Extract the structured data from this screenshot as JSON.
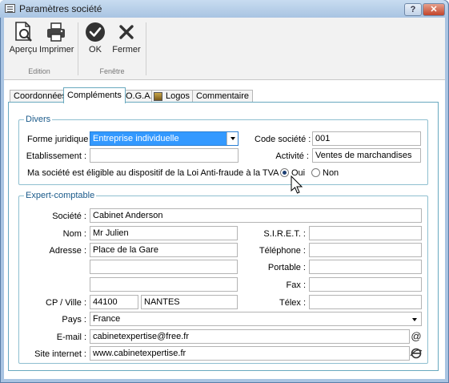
{
  "window": {
    "title": "Paramètres société",
    "help_label": "?",
    "close_label": "✕"
  },
  "toolbar": {
    "apercu": "Aperçu",
    "imprimer": "Imprimer",
    "ok": "OK",
    "fermer": "Fermer",
    "group_edition": "Edition",
    "group_fenetre": "Fenêtre"
  },
  "tabs": [
    "Coordonnées",
    "Compléments",
    "O.G.A.",
    "Logos",
    "Commentaire"
  ],
  "divers": {
    "title": "Divers",
    "forme_label": "Forme juridique :",
    "forme_value": "Entreprise individuelle",
    "code_label": "Code société :",
    "code_value": "001",
    "etablissement_label": "Etablissement :",
    "etablissement_value": "",
    "activite_label": "Activité :",
    "activite_value": "Ventes de marchandises",
    "antifraude_text": "Ma société est éligible au dispositif de la Loi Anti-fraude à la TVA",
    "oui_label": "Oui",
    "non_label": "Non",
    "antifraude_selected": "Oui"
  },
  "expert": {
    "title": "Expert-comptable",
    "societe_label": "Société :",
    "societe_value": "Cabinet Anderson",
    "nom_label": "Nom :",
    "nom_value": "Mr Julien",
    "siret_label": "S.I.R.E.T. :",
    "siret_value": "",
    "adresse_label": "Adresse :",
    "adresse_value": "Place de la Gare",
    "adresse2_value": "",
    "adresse3_value": "",
    "telephone_label": "Téléphone :",
    "telephone_value": "",
    "portable_label": "Portable :",
    "portable_value": "",
    "fax_label": "Fax :",
    "fax_value": "",
    "cpville_label": "CP / Ville :",
    "cp_value": "44100",
    "ville_value": "NANTES",
    "telex_label": "Télex :",
    "telex_value": "",
    "pays_label": "Pays :",
    "pays_value": "France",
    "email_label": "E-mail :",
    "email_value": "cabinetexpertise@free.fr",
    "site_label": "Site internet :",
    "site_value": "www.cabinetexpertise.fr"
  },
  "colors": {
    "selection": "#3399ff",
    "frame": "#a9c4e2",
    "group_border": "#8fbfd0",
    "group_title": "#1a5a8a"
  }
}
